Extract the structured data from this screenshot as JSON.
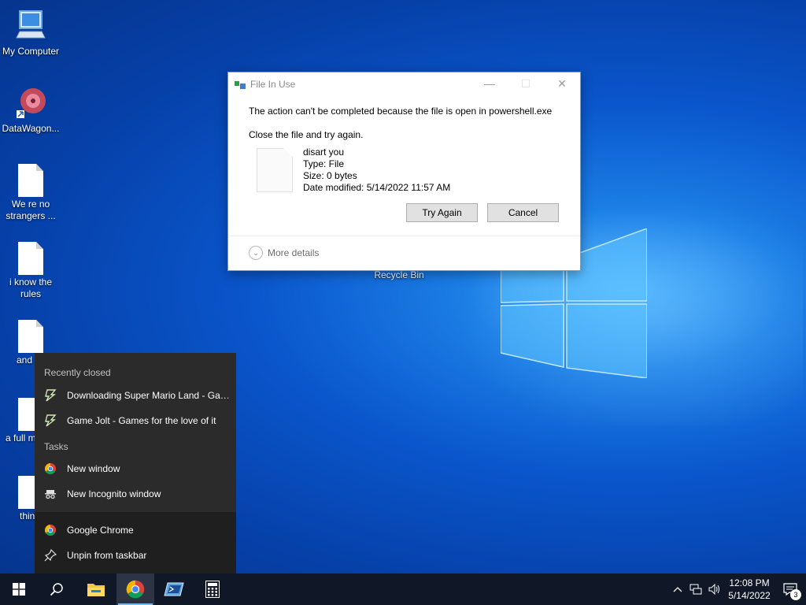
{
  "desktop": {
    "icons": [
      {
        "label": "My Computer"
      },
      {
        "label": "DataWagon..."
      },
      {
        "label": "We re no strangers ..."
      },
      {
        "label": "i know the rules"
      },
      {
        "label": "and so"
      },
      {
        "label": "a full m fuck"
      },
      {
        "label": "thinki"
      },
      {
        "label": "Recycle Bin"
      }
    ]
  },
  "dialog": {
    "title": "File In Use",
    "message": "The action can't be completed because the file is open in powershell.exe",
    "instruction": "Close the file and try again.",
    "file": {
      "name": "disart you",
      "type": "Type: File",
      "size": "Size: 0 bytes",
      "modified": "Date modified: 5/14/2022 11:57 AM"
    },
    "try_again_label": "Try Again",
    "cancel_label": "Cancel",
    "more_details_label": "More details",
    "controls": {
      "minimize": "—",
      "maximize": "☐",
      "close": "✕"
    }
  },
  "jumplist": {
    "recently_closed_header": "Recently closed",
    "recent": [
      {
        "label": "Downloading Super Mario Land - Game Jolt",
        "icon": "game-jolt-icon"
      },
      {
        "label": "Game Jolt - Games for the love of it",
        "icon": "game-jolt-icon"
      }
    ],
    "tasks_header": "Tasks",
    "tasks": [
      {
        "label": "New window",
        "icon": "chrome-icon"
      },
      {
        "label": "New Incognito window",
        "icon": "incognito-icon"
      }
    ],
    "app_items": [
      {
        "label": "Google Chrome",
        "icon": "chrome-icon"
      },
      {
        "label": "Unpin from taskbar",
        "icon": "unpin-icon"
      }
    ]
  },
  "taskbar": {
    "apps": [
      "start-icon",
      "search-icon",
      "file-explorer-icon",
      "chrome-icon",
      "powershell-icon",
      "calculator-icon"
    ],
    "clock": {
      "time": "12:08 PM",
      "date": "5/14/2022"
    },
    "notification_count": "3"
  },
  "colors": {
    "taskbar": "#101727",
    "jumplist": "#2b2b2b",
    "accent": "#76b9ed"
  }
}
